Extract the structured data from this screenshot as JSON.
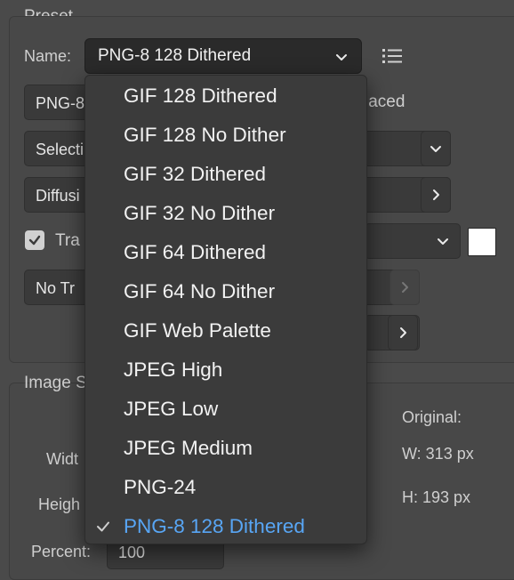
{
  "preset": {
    "title": "Preset",
    "name_label": "Name:",
    "name_value": "PNG-8 128 Dithered",
    "left_fields": [
      "PNG-8",
      "Selecti",
      "Diffusi",
      "Tra",
      "No Tr"
    ],
    "interlaced_label": "laced"
  },
  "menu": {
    "items": [
      "GIF 128 Dithered",
      "GIF 128 No Dither",
      "GIF 32 Dithered",
      "GIF 32 No Dither",
      "GIF 64 Dithered",
      "GIF 64 No Dither",
      "GIF Web Palette",
      "JPEG High",
      "JPEG Low",
      "JPEG Medium",
      "PNG-24",
      "PNG-8 128 Dithered"
    ],
    "selected": "PNG-8 128 Dithered"
  },
  "image_size": {
    "title": "Image S",
    "width_label": "Widt",
    "height_label": "Heigh",
    "percent_label": "Percent:",
    "percent_value": "100",
    "original_label": "Original:",
    "orig_w": "W:  313 px",
    "orig_h": "H:  193 px"
  },
  "colors": {
    "accent": "#58a6f5",
    "background": "#4a4a4a",
    "menu_bg": "#3b3b3b"
  }
}
